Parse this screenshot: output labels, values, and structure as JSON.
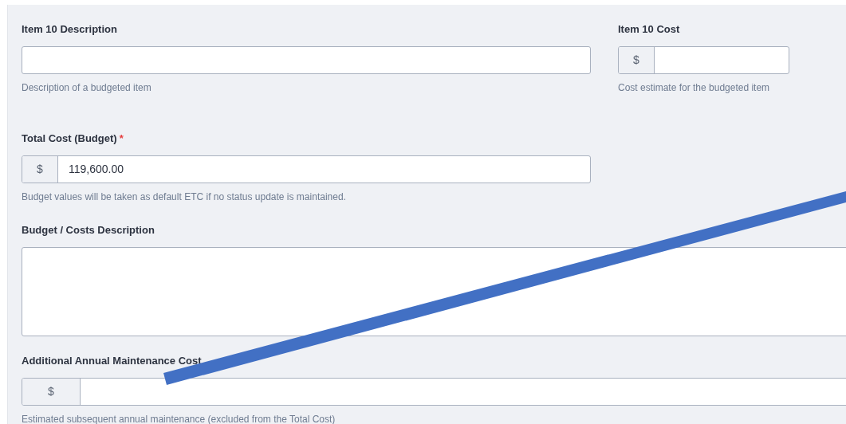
{
  "rows": [
    {
      "fields": [
        {
          "kind": "text",
          "label": "Item 10 Description",
          "help": "Description of a budgeted item"
        },
        {
          "kind": "currency",
          "label": "Item 10 Cost",
          "prefix": "$",
          "help": "Cost estimate for the budgeted item"
        }
      ]
    },
    {
      "fields": [
        {
          "kind": "currency",
          "label": "Total Cost (Budget)",
          "required_mark": "*",
          "prefix": "$",
          "value": "119,600.00",
          "help": "Budget values will be taken as default ETC if no status update is maintained."
        }
      ]
    },
    {
      "fields": [
        {
          "kind": "textarea",
          "label": "Budget / Costs Description"
        }
      ]
    },
    {
      "fields": [
        {
          "kind": "currency",
          "label": "Additional Annual Maintenance Cost",
          "prefix": "$",
          "help": "Estimated subsequent annual maintenance (excluded from the Total Cost)"
        }
      ]
    }
  ]
}
